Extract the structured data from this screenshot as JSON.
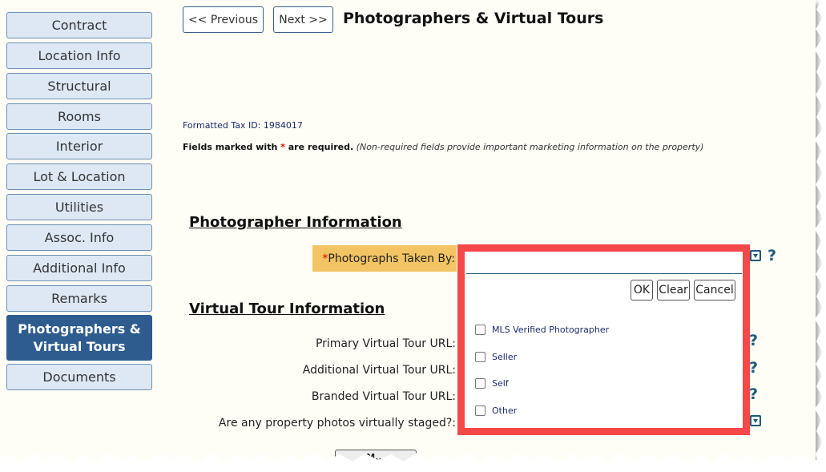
{
  "sidebar": {
    "items": [
      {
        "label": "Contract"
      },
      {
        "label": "Location Info"
      },
      {
        "label": "Structural"
      },
      {
        "label": "Rooms"
      },
      {
        "label": "Interior"
      },
      {
        "label": "Lot & Location"
      },
      {
        "label": "Utilities"
      },
      {
        "label": "Assoc. Info"
      },
      {
        "label": "Additional Info"
      },
      {
        "label": "Remarks"
      },
      {
        "label": "Photographers & Virtual Tours"
      },
      {
        "label": "Documents"
      }
    ],
    "active_index": 10
  },
  "header": {
    "previous_label": "<< Previous",
    "next_label": "Next >>",
    "title": "Photographers & Virtual Tours"
  },
  "info": {
    "tax_id": "Formatted Tax ID: 1984017",
    "required_prefix": "Fields marked with ",
    "required_star": "*",
    "required_suffix": " are required.",
    "required_note": "(Non-required fields provide important marketing information on the property)"
  },
  "photographer_section": {
    "heading": "Photographer Information",
    "photos_taken_star": "*",
    "photos_taken_label": "Photographs Taken By:",
    "photos_taken_value": ""
  },
  "dropdown": {
    "ok_label": "OK",
    "clear_label": "Clear",
    "cancel_label": "Cancel",
    "options": [
      {
        "label": "MLS Verified Photographer",
        "checked": false
      },
      {
        "label": "Seller",
        "checked": false
      },
      {
        "label": "Self",
        "checked": false
      },
      {
        "label": "Other",
        "checked": false
      }
    ]
  },
  "virtual_tour_section": {
    "heading": "Virtual Tour Information",
    "primary_label": "Primary Virtual Tour URL:",
    "additional_label": "Additional Virtual Tour URL:",
    "branded_label": "Branded Virtual Tour URL:",
    "staged_label": "Are any property photos virtually staged?:"
  },
  "help_glyph": "?",
  "bottom_button_label": "M..."
}
